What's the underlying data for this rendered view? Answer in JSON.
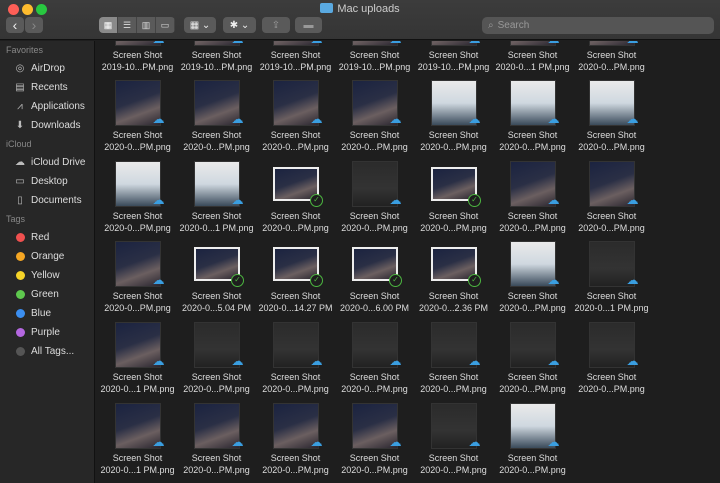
{
  "window": {
    "title": "Mac uploads"
  },
  "toolbar": {
    "back": "‹",
    "forward": "›",
    "views": [
      "▦",
      "☰",
      "▥",
      "▭"
    ],
    "group": "▦ ⌄",
    "action": "✱ ⌄",
    "share": "⇪",
    "tag": "▬",
    "search_placeholder": "Search"
  },
  "sidebar": {
    "favorites_header": "Favorites",
    "favorites": [
      {
        "label": "AirDrop",
        "icon": "◎"
      },
      {
        "label": "Recents",
        "icon": "▤"
      },
      {
        "label": "Applications",
        "icon": "⩘"
      },
      {
        "label": "Downloads",
        "icon": "⬇"
      }
    ],
    "icloud_header": "iCloud",
    "icloud": [
      {
        "label": "iCloud Drive",
        "icon": "☁"
      },
      {
        "label": "Desktop",
        "icon": "▭"
      },
      {
        "label": "Documents",
        "icon": "▯"
      }
    ],
    "tags_header": "Tags",
    "tags": [
      {
        "label": "Red",
        "color": "#f0504f"
      },
      {
        "label": "Orange",
        "color": "#f5a623"
      },
      {
        "label": "Yellow",
        "color": "#f5d328"
      },
      {
        "label": "Green",
        "color": "#5ec84e"
      },
      {
        "label": "Blue",
        "color": "#3b8ef0"
      },
      {
        "label": "Purple",
        "color": "#b467e0"
      },
      {
        "label": "All Tags...",
        "color": "#555"
      }
    ]
  },
  "files": [
    {
      "name": "Screen Shot",
      "sub": "2019-10...PM.png",
      "status": "cloud",
      "kind": "p"
    },
    {
      "name": "Screen Shot",
      "sub": "2019-10...PM.png",
      "status": "cloud",
      "kind": "p"
    },
    {
      "name": "Screen Shot",
      "sub": "2019-10...PM.png",
      "status": "cloud",
      "kind": "p"
    },
    {
      "name": "Screen Shot",
      "sub": "2019-10...PM.png",
      "status": "cloud",
      "kind": "p"
    },
    {
      "name": "Screen Shot",
      "sub": "2019-10...PM.png",
      "status": "cloud",
      "kind": "p"
    },
    {
      "name": "Screen Shot",
      "sub": "2020-0...1 PM.png",
      "status": "cloud",
      "kind": "p"
    },
    {
      "name": "Screen Shot",
      "sub": "2020-0...PM.png",
      "status": "cloud",
      "kind": "p"
    },
    {
      "name": "Screen Shot",
      "sub": "2020-0...PM.png",
      "status": "cloud",
      "kind": "p"
    },
    {
      "name": "Screen Shot",
      "sub": "2020-0...PM.png",
      "status": "cloud",
      "kind": "p"
    },
    {
      "name": "Screen Shot",
      "sub": "2020-0...PM.png",
      "status": "cloud",
      "kind": "p"
    },
    {
      "name": "Screen Shot",
      "sub": "2020-0...PM.png",
      "status": "cloud",
      "kind": "p"
    },
    {
      "name": "Screen Shot",
      "sub": "2020-0...PM.png",
      "status": "cloud",
      "kind": "w"
    },
    {
      "name": "Screen Shot",
      "sub": "2020-0...PM.png",
      "status": "cloud",
      "kind": "w"
    },
    {
      "name": "Screen Shot",
      "sub": "2020-0...PM.png",
      "status": "cloud",
      "kind": "w"
    },
    {
      "name": "Screen Shot",
      "sub": "2020-0...PM.png",
      "status": "cloud",
      "kind": "w"
    },
    {
      "name": "Screen Shot",
      "sub": "2020-0...1 PM.png",
      "status": "cloud",
      "kind": "w"
    },
    {
      "name": "Screen Shot",
      "sub": "2020-0...PM.png",
      "status": "check",
      "kind": "l"
    },
    {
      "name": "Screen Shot",
      "sub": "2020-0...PM.png",
      "status": "cloud",
      "kind": "d"
    },
    {
      "name": "Screen Shot",
      "sub": "2020-0...PM.png",
      "status": "check",
      "kind": "l"
    },
    {
      "name": "Screen Shot",
      "sub": "2020-0...PM.png",
      "status": "cloud",
      "kind": "p"
    },
    {
      "name": "Screen Shot",
      "sub": "2020-0...PM.png",
      "status": "cloud",
      "kind": "p"
    },
    {
      "name": "Screen Shot",
      "sub": "2020-0...PM.png",
      "status": "cloud",
      "kind": "p"
    },
    {
      "name": "Screen Shot",
      "sub": "2020-0...5.04 PM",
      "status": "check",
      "kind": "l"
    },
    {
      "name": "Screen Shot",
      "sub": "2020-0...14.27 PM",
      "status": "check",
      "kind": "l"
    },
    {
      "name": "Screen Shot",
      "sub": "2020-0...6.00 PM",
      "status": "check",
      "kind": "l"
    },
    {
      "name": "Screen Shot",
      "sub": "2020-0...2.36 PM",
      "status": "check",
      "kind": "l"
    },
    {
      "name": "Screen Shot",
      "sub": "2020-0...PM.png",
      "status": "cloud",
      "kind": "w"
    },
    {
      "name": "Screen Shot",
      "sub": "2020-0...1 PM.png",
      "status": "cloud",
      "kind": "d"
    },
    {
      "name": "Screen Shot",
      "sub": "2020-0...1 PM.png",
      "status": "cloud",
      "kind": "p"
    },
    {
      "name": "Screen Shot",
      "sub": "2020-0...PM.png",
      "status": "cloud",
      "kind": "d"
    },
    {
      "name": "Screen Shot",
      "sub": "2020-0...PM.png",
      "status": "cloud",
      "kind": "d"
    },
    {
      "name": "Screen Shot",
      "sub": "2020-0...PM.png",
      "status": "cloud",
      "kind": "d"
    },
    {
      "name": "Screen Shot",
      "sub": "2020-0...PM.png",
      "status": "cloud",
      "kind": "d"
    },
    {
      "name": "Screen Shot",
      "sub": "2020-0...PM.png",
      "status": "cloud",
      "kind": "d"
    },
    {
      "name": "Screen Shot",
      "sub": "2020-0...PM.png",
      "status": "cloud",
      "kind": "d"
    },
    {
      "name": "Screen Shot",
      "sub": "2020-0...1 PM.png",
      "status": "cloud",
      "kind": "p"
    },
    {
      "name": "Screen Shot",
      "sub": "2020-0...PM.png",
      "status": "cloud",
      "kind": "p"
    },
    {
      "name": "Screen Shot",
      "sub": "2020-0...PM.png",
      "status": "cloud",
      "kind": "p"
    },
    {
      "name": "Screen Shot",
      "sub": "2020-0...PM.png",
      "status": "cloud",
      "kind": "p"
    },
    {
      "name": "Screen Shot",
      "sub": "2020-0...PM.png",
      "status": "cloud",
      "kind": "d"
    },
    {
      "name": "Screen Shot",
      "sub": "2020-0...PM.png",
      "status": "cloud",
      "kind": "w"
    }
  ]
}
